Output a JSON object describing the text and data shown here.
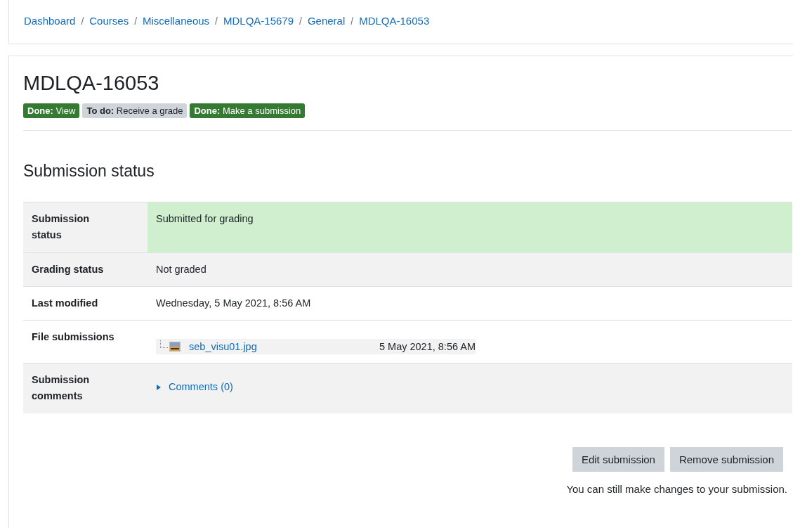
{
  "breadcrumb_separator": "/",
  "breadcrumb": [
    "Dashboard",
    "Courses",
    "Miscellaneous",
    "MDLQA-15679",
    "General",
    "MDLQA-16053"
  ],
  "title": "MDLQA-16053",
  "badges": [
    {
      "kind": "done",
      "prefix": "Done:",
      "label": "View"
    },
    {
      "kind": "todo",
      "prefix": "To do:",
      "label": "Receive a grade"
    },
    {
      "kind": "done",
      "prefix": "Done:",
      "label": "Make a submission"
    }
  ],
  "section_title": "Submission status",
  "rows": [
    {
      "kind": "text",
      "label": "Submission status",
      "value": "Submitted for grading",
      "highlight": true,
      "shaded": true
    },
    {
      "kind": "text",
      "label": "Grading status",
      "value": "Not graded",
      "highlight": false,
      "shaded": true
    },
    {
      "kind": "text",
      "label": "Last modified",
      "value": "Wednesday, 5 May 2021, 8:56 AM",
      "highlight": false,
      "shaded": false
    },
    {
      "kind": "files",
      "label": "File submissions",
      "file": {
        "name": "seb_visu01.jpg",
        "date": "5 May 2021, 8:56 AM"
      },
      "highlight": false,
      "shaded": false
    },
    {
      "kind": "comments",
      "label": "Submission comments",
      "link": "Comments (0)",
      "expanded": false,
      "highlight": false,
      "shaded": true
    }
  ],
  "buttons": [
    "Edit submission",
    "Remove submission"
  ],
  "note": "You can still make changes to your submission."
}
